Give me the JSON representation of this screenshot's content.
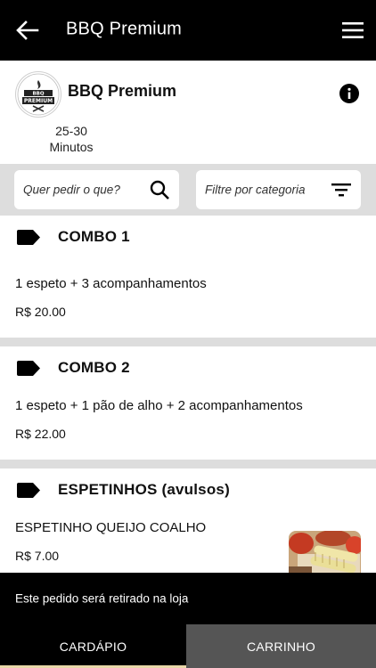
{
  "topbar": {
    "title": "BBQ Premium",
    "back_icon": "arrow-left-icon",
    "menu_icon": "hamburger-menu-icon"
  },
  "store": {
    "name": "BBQ Premium",
    "logo_text": "BBQ PREMIUM",
    "eta_range": "25-30",
    "eta_unit": "Minutos",
    "info_icon": "info-icon"
  },
  "search": {
    "placeholder": "Quer pedir o que?"
  },
  "category_filter": {
    "placeholder": "Filtre por categoria"
  },
  "sections": [
    {
      "label": "COMBO 1",
      "items": [
        {
          "title": "1 espeto + 3 acompanhamentos",
          "price": "R$ 20.00"
        }
      ]
    },
    {
      "label": "COMBO 2",
      "items": [
        {
          "title": "1 espeto + 1 pão de alho + 2 acompanhamentos",
          "price": "R$ 22.00"
        }
      ]
    },
    {
      "label": "ESPETINHOS (avulsos)",
      "items": [
        {
          "title": "ESPETINHO QUEIJO COALHO",
          "price": "R$ 7.00"
        }
      ]
    }
  ],
  "notice": "Este pedido será retirado na loja",
  "tabs": [
    {
      "label": "CARDÁPIO",
      "active": true
    },
    {
      "label": "CARRINHO",
      "active": false
    }
  ],
  "colors": {
    "topbar": "#000000",
    "divider": "#dddddd",
    "tab_inactive": "#555555",
    "tab_underline": "#e8d7a8"
  }
}
